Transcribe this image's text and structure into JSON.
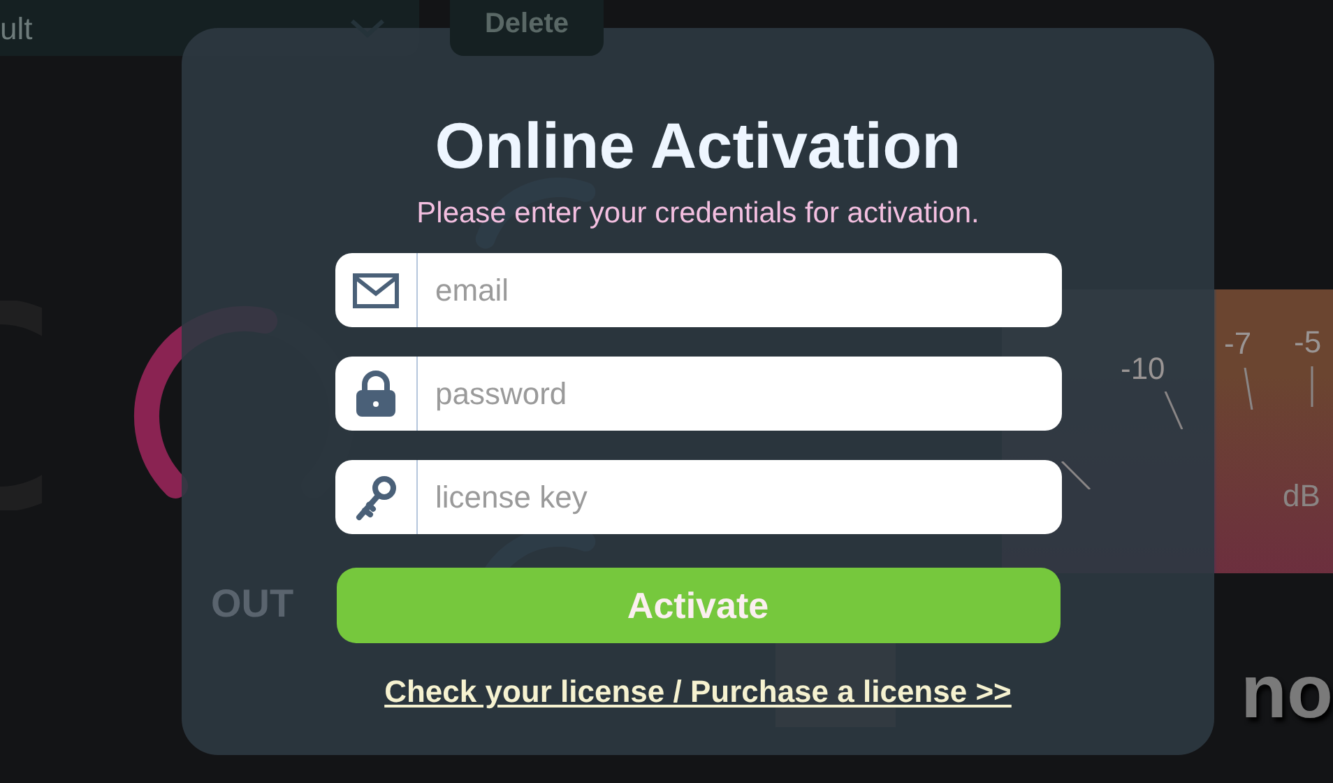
{
  "background": {
    "preset": {
      "value": "ult"
    },
    "delete_button": "Delete",
    "out_knob": {
      "label": "OUT"
    },
    "meter": {
      "ticks": [
        "-10",
        "-7",
        "-5"
      ],
      "unit": "dB"
    },
    "brand": "no"
  },
  "dialog": {
    "title": "Online Activation",
    "subtitle": "Please enter your credentials for activation.",
    "fields": [
      {
        "kind": "email",
        "placeholder": "email"
      },
      {
        "kind": "password",
        "placeholder": "password"
      },
      {
        "kind": "key",
        "placeholder": "license key"
      }
    ],
    "button": "Activate",
    "link": "Check your license / Purchase a license >>"
  }
}
